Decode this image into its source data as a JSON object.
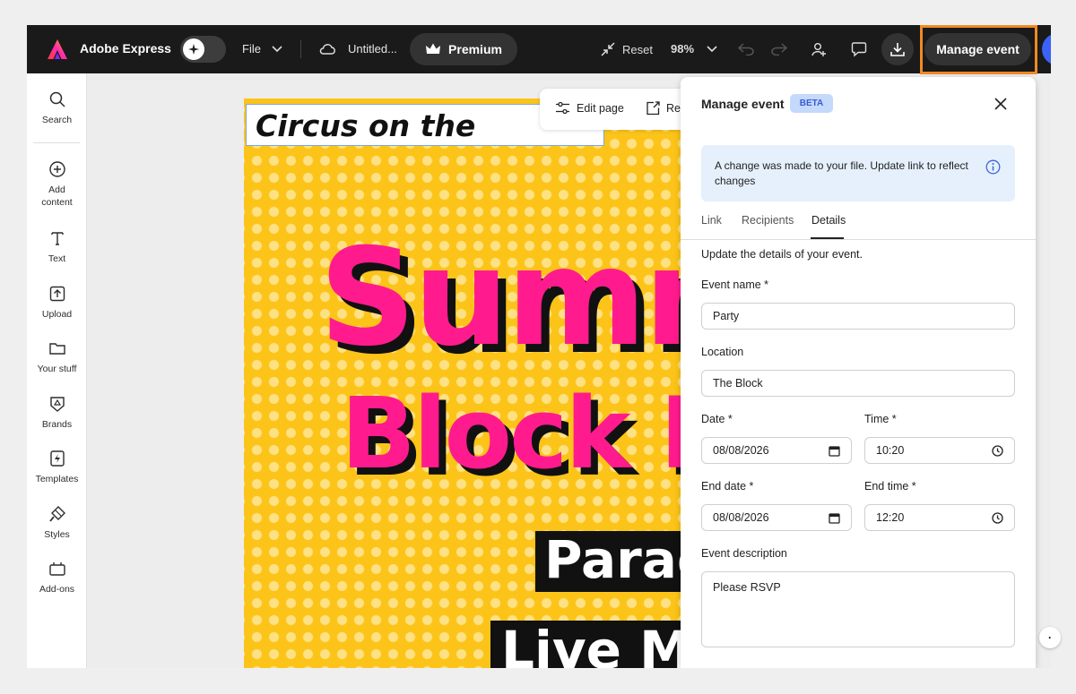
{
  "topbar": {
    "brand": "Adobe Express",
    "file_label": "File",
    "doc_title": "Untitled...",
    "premium_label": "Premium",
    "reset_label": "Reset",
    "zoom_label": "98%",
    "manage_event_label": "Manage event"
  },
  "rail": {
    "items": [
      {
        "label": "Search",
        "icon": "search-icon"
      },
      {
        "label": "Add content",
        "icon": "plus-circle-icon"
      },
      {
        "label": "Text",
        "icon": "text-icon"
      },
      {
        "label": "Upload",
        "icon": "upload-icon"
      },
      {
        "label": "Your stuff",
        "icon": "folder-icon"
      },
      {
        "label": "Brands",
        "icon": "brand-icon"
      },
      {
        "label": "Templates",
        "icon": "templates-icon"
      },
      {
        "label": "Styles",
        "icon": "styles-icon"
      },
      {
        "label": "Add-ons",
        "icon": "addons-icon"
      }
    ]
  },
  "canvas": {
    "circus_text": "Circus on the",
    "big_word_1": "Summ",
    "big_word_2": "Block P",
    "banner_1": "Parad",
    "banner_2": "Live Mu",
    "toolbar_edit_page": "Edit page",
    "toolbar_resize": "Res"
  },
  "panel": {
    "title": "Manage event",
    "badge": "BETA",
    "notice": "A change was made to your file. Update link to reflect changes",
    "tabs": [
      "Link",
      "Recipients",
      "Details"
    ],
    "active_tab": "Details",
    "description": "Update the details of your event.",
    "event_name_label": "Event name *",
    "event_name_value": "Party",
    "location_label": "Location",
    "location_value": "The Block",
    "date_label": "Date *",
    "date_value": "08/08/2026",
    "time_label": "Time *",
    "time_value": "10:20",
    "end_date_label": "End date *",
    "end_date_value": "08/08/2026",
    "end_time_label": "End time *",
    "end_time_value": "12:20",
    "event_description_label": "Event description",
    "event_description_value": "Please RSVP"
  },
  "colors": {
    "poster_bg": "#fcc419",
    "headline_pink": "#ff1b8d",
    "highlight_orange": "#f08a24",
    "beta_bg": "#c5d9fb"
  }
}
